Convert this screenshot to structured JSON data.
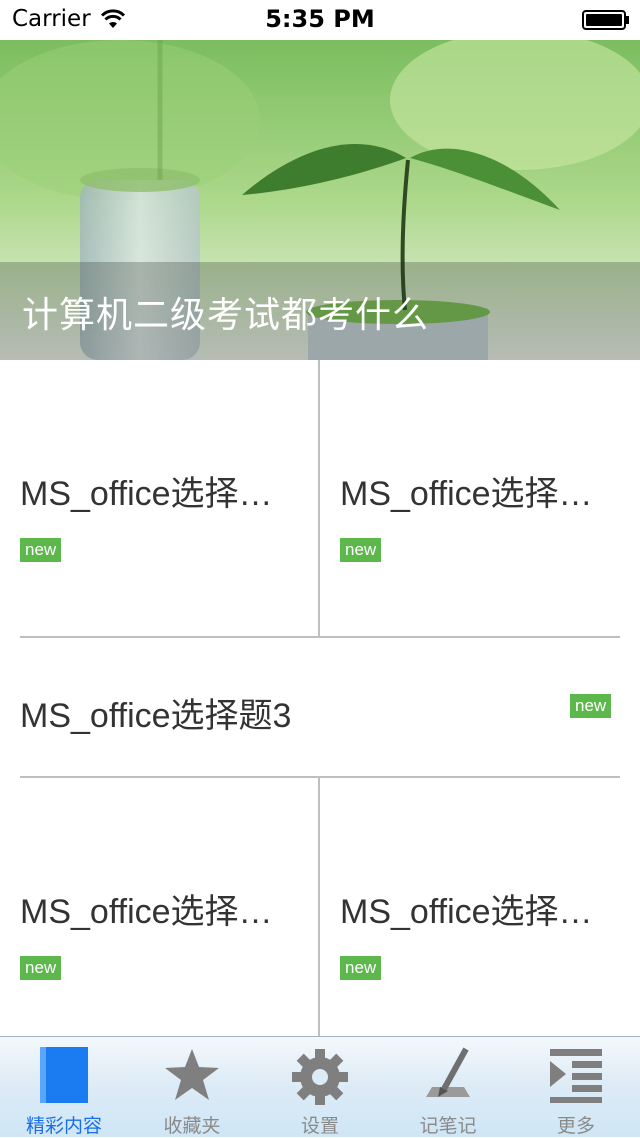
{
  "status_bar": {
    "carrier": "Carrier",
    "time": "5:35 PM"
  },
  "banner": {
    "title": "计算机二级考试都考什么"
  },
  "items": [
    {
      "title": "MS_office选择…",
      "badge": "new"
    },
    {
      "title": "MS_office选择…",
      "badge": "new"
    },
    {
      "title": "MS_office选择题3",
      "badge": "new"
    },
    {
      "title": "MS_office选择…",
      "badge": "new"
    },
    {
      "title": "MS_office选择…",
      "badge": "new"
    }
  ],
  "tabs": [
    {
      "label": "精彩内容",
      "icon": "featured-icon",
      "active": true
    },
    {
      "label": "收藏夹",
      "icon": "star-icon",
      "active": false
    },
    {
      "label": "设置",
      "icon": "gear-icon",
      "active": false
    },
    {
      "label": "记笔记",
      "icon": "pen-icon",
      "active": false
    },
    {
      "label": "更多",
      "icon": "more-list-icon",
      "active": false
    }
  ],
  "colors": {
    "accent": "#1a6fe8",
    "badge": "#5db84b",
    "divider": "#bfbfbf"
  }
}
